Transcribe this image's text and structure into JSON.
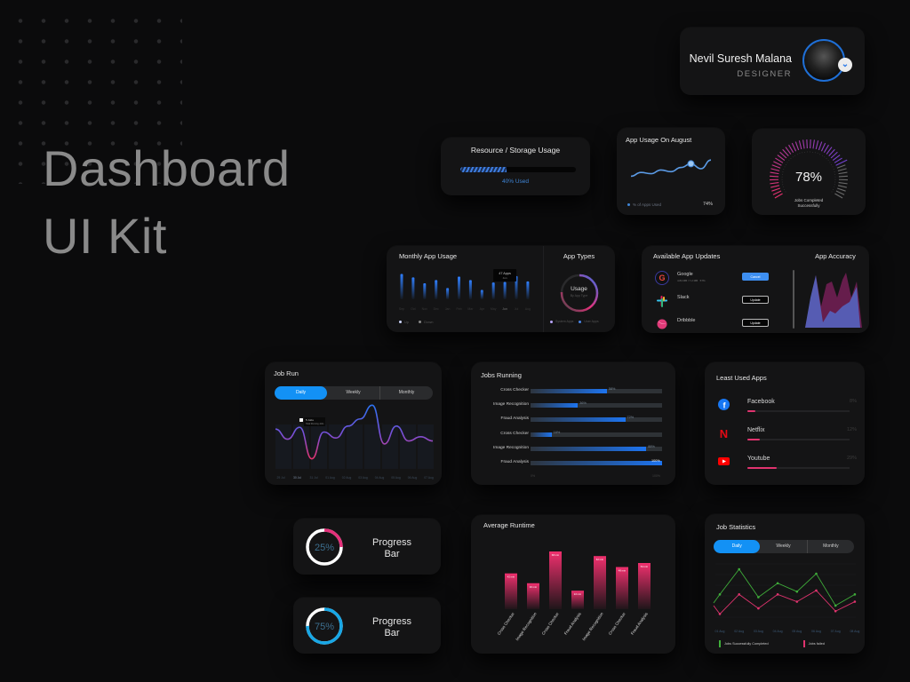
{
  "hero": {
    "line1": "Dashboard",
    "line2": "UI Kit"
  },
  "profile": {
    "name": "Nevil Suresh Malana",
    "role": "DESIGNER",
    "accent": "#1f6fd6"
  },
  "storage": {
    "title": "Resource / Storage Usage",
    "used_fraction": 0.4,
    "label": "40% Used"
  },
  "app_usage_august": {
    "title": "App Usage On August",
    "legend": "% of Apps Used",
    "value": "74%",
    "points": [
      0.2,
      0.35,
      0.3,
      0.45,
      0.38,
      0.55,
      0.7,
      0.5,
      0.85
    ],
    "highlight_index": 6
  },
  "jobs_gauge": {
    "value": "78%",
    "fraction": 0.78,
    "caption_line1": "Jobs Completed",
    "caption_line2": "Successfully"
  },
  "monthly_app_usage": {
    "title": "Monthly App Usage",
    "tooltip_line1": "47 Apps",
    "tooltip_line2": "Jun",
    "months": [
      "Sep",
      "Oct",
      "Nov",
      "Dec",
      "Jan",
      "Feb",
      "Mar",
      "Apr",
      "May",
      "Jun",
      "Jul",
      "Aug"
    ],
    "values": [
      0.95,
      0.82,
      0.6,
      0.72,
      0.42,
      0.85,
      0.72,
      0.35,
      0.63,
      0.65,
      0.87,
      0.67
    ],
    "highlight_index": 9,
    "legend": [
      "Up",
      "Down"
    ]
  },
  "app_types": {
    "title": "App Types",
    "center": "Usage",
    "subcenter": "By App Type",
    "legend": [
      "System Apps",
      "User Apps"
    ]
  },
  "app_updates": {
    "title": "Available App Updates",
    "items": [
      {
        "name": "Google",
        "meta": "4.84 MB / 7.2 MB   57%",
        "button": "Cancel",
        "primary": true,
        "icon": "google-icon"
      },
      {
        "name": "Slack",
        "meta": "",
        "button": "Update",
        "primary": false,
        "icon": "slack-icon"
      },
      {
        "name": "Dribbble",
        "meta": "",
        "button": "Update",
        "primary": false,
        "icon": "dribbble-icon"
      }
    ]
  },
  "app_accuracy": {
    "title": "App Accuracy"
  },
  "job_run": {
    "title": "Job Run",
    "tabs": [
      "Daily",
      "Weekly",
      "Monthly"
    ],
    "active_tab": 0,
    "tooltip_line1": "5 Jobs",
    "tooltip_line2": "Total Running Jobs",
    "dates": [
      "29 Jul",
      "30 Jul",
      "31 Jul",
      "01 Aug",
      "02 Aug",
      "03 Aug",
      "04 Aug",
      "05 Aug",
      "06 Aug",
      "07 Aug"
    ],
    "values": [
      0.55,
      0.38,
      0.58,
      0.05,
      0.5,
      0.4,
      0.6,
      0.72,
      0.95,
      0.3,
      0.6,
      0.35,
      0.42,
      0.35
    ]
  },
  "jobs_running": {
    "title": "Jobs Running",
    "rows": [
      {
        "label": "Cross Checker",
        "value": 58
      },
      {
        "label": "Image Recognition",
        "value": 36
      },
      {
        "label": "Fraud Analysis",
        "value": 72
      },
      {
        "label": "Cross Checker",
        "value": 16
      },
      {
        "label": "Image Recognition",
        "value": 88
      },
      {
        "label": "Fraud Analysis",
        "value": 100
      }
    ],
    "axis_min": "0%",
    "axis_max": "100%"
  },
  "least_used": {
    "title": "Least Used Apps",
    "items": [
      {
        "name": "Facebook",
        "value": "8%",
        "fraction": 0.08,
        "icon": "facebook-icon"
      },
      {
        "name": "Netflix",
        "value": "12%",
        "fraction": 0.12,
        "icon": "netflix-icon"
      },
      {
        "name": "Youtube",
        "value": "29%",
        "fraction": 0.29,
        "icon": "youtube-icon"
      }
    ]
  },
  "progress": [
    {
      "value": "25%",
      "fraction": 0.25,
      "label1": "Progress",
      "label2": "Bar",
      "color": "#e4307a",
      "track": "#ffffff",
      "text_color": "#3d6f8f"
    },
    {
      "value": "75%",
      "fraction": 0.75,
      "label1": "Progress",
      "label2": "Bar",
      "color": "#17a7e6",
      "track": "#ffffff",
      "text_color": "#3d6f8f"
    }
  ],
  "avg_runtime": {
    "title": "Average Runtime",
    "categories": [
      "Cross Checker",
      "Image Recognition",
      "Cross Checker",
      "Fraud Analysis",
      "Image Recognition",
      "Cross Checker",
      "Fraud Analysis"
    ],
    "values": [
      0.62,
      0.45,
      1.0,
      0.32,
      0.92,
      0.73,
      0.8
    ],
    "labels": [
      "42 min",
      "30 min",
      "68 min",
      "22 min",
      "62 min",
      "48 min",
      "54 min"
    ]
  },
  "job_stats": {
    "title": "Job Statistics",
    "tabs": [
      "Daily",
      "Weekly",
      "Monthly"
    ],
    "active_tab": 0,
    "dates": [
      "01 Aug",
      "02 Aug",
      "03 Aug",
      "04 Aug",
      "05 Aug",
      "06 Aug",
      "07 Aug",
      "08 Aug"
    ],
    "completed": [
      0.55,
      1.0,
      0.5,
      0.75,
      0.6,
      0.92,
      0.35,
      0.55
    ],
    "failed": [
      0.2,
      0.55,
      0.3,
      0.55,
      0.42,
      0.62,
      0.25,
      0.42
    ],
    "legend": [
      "Jobs Successfully Completed",
      "Jobs failed"
    ],
    "colors": {
      "completed": "#3fae3a",
      "failed": "#e0336e"
    }
  }
}
